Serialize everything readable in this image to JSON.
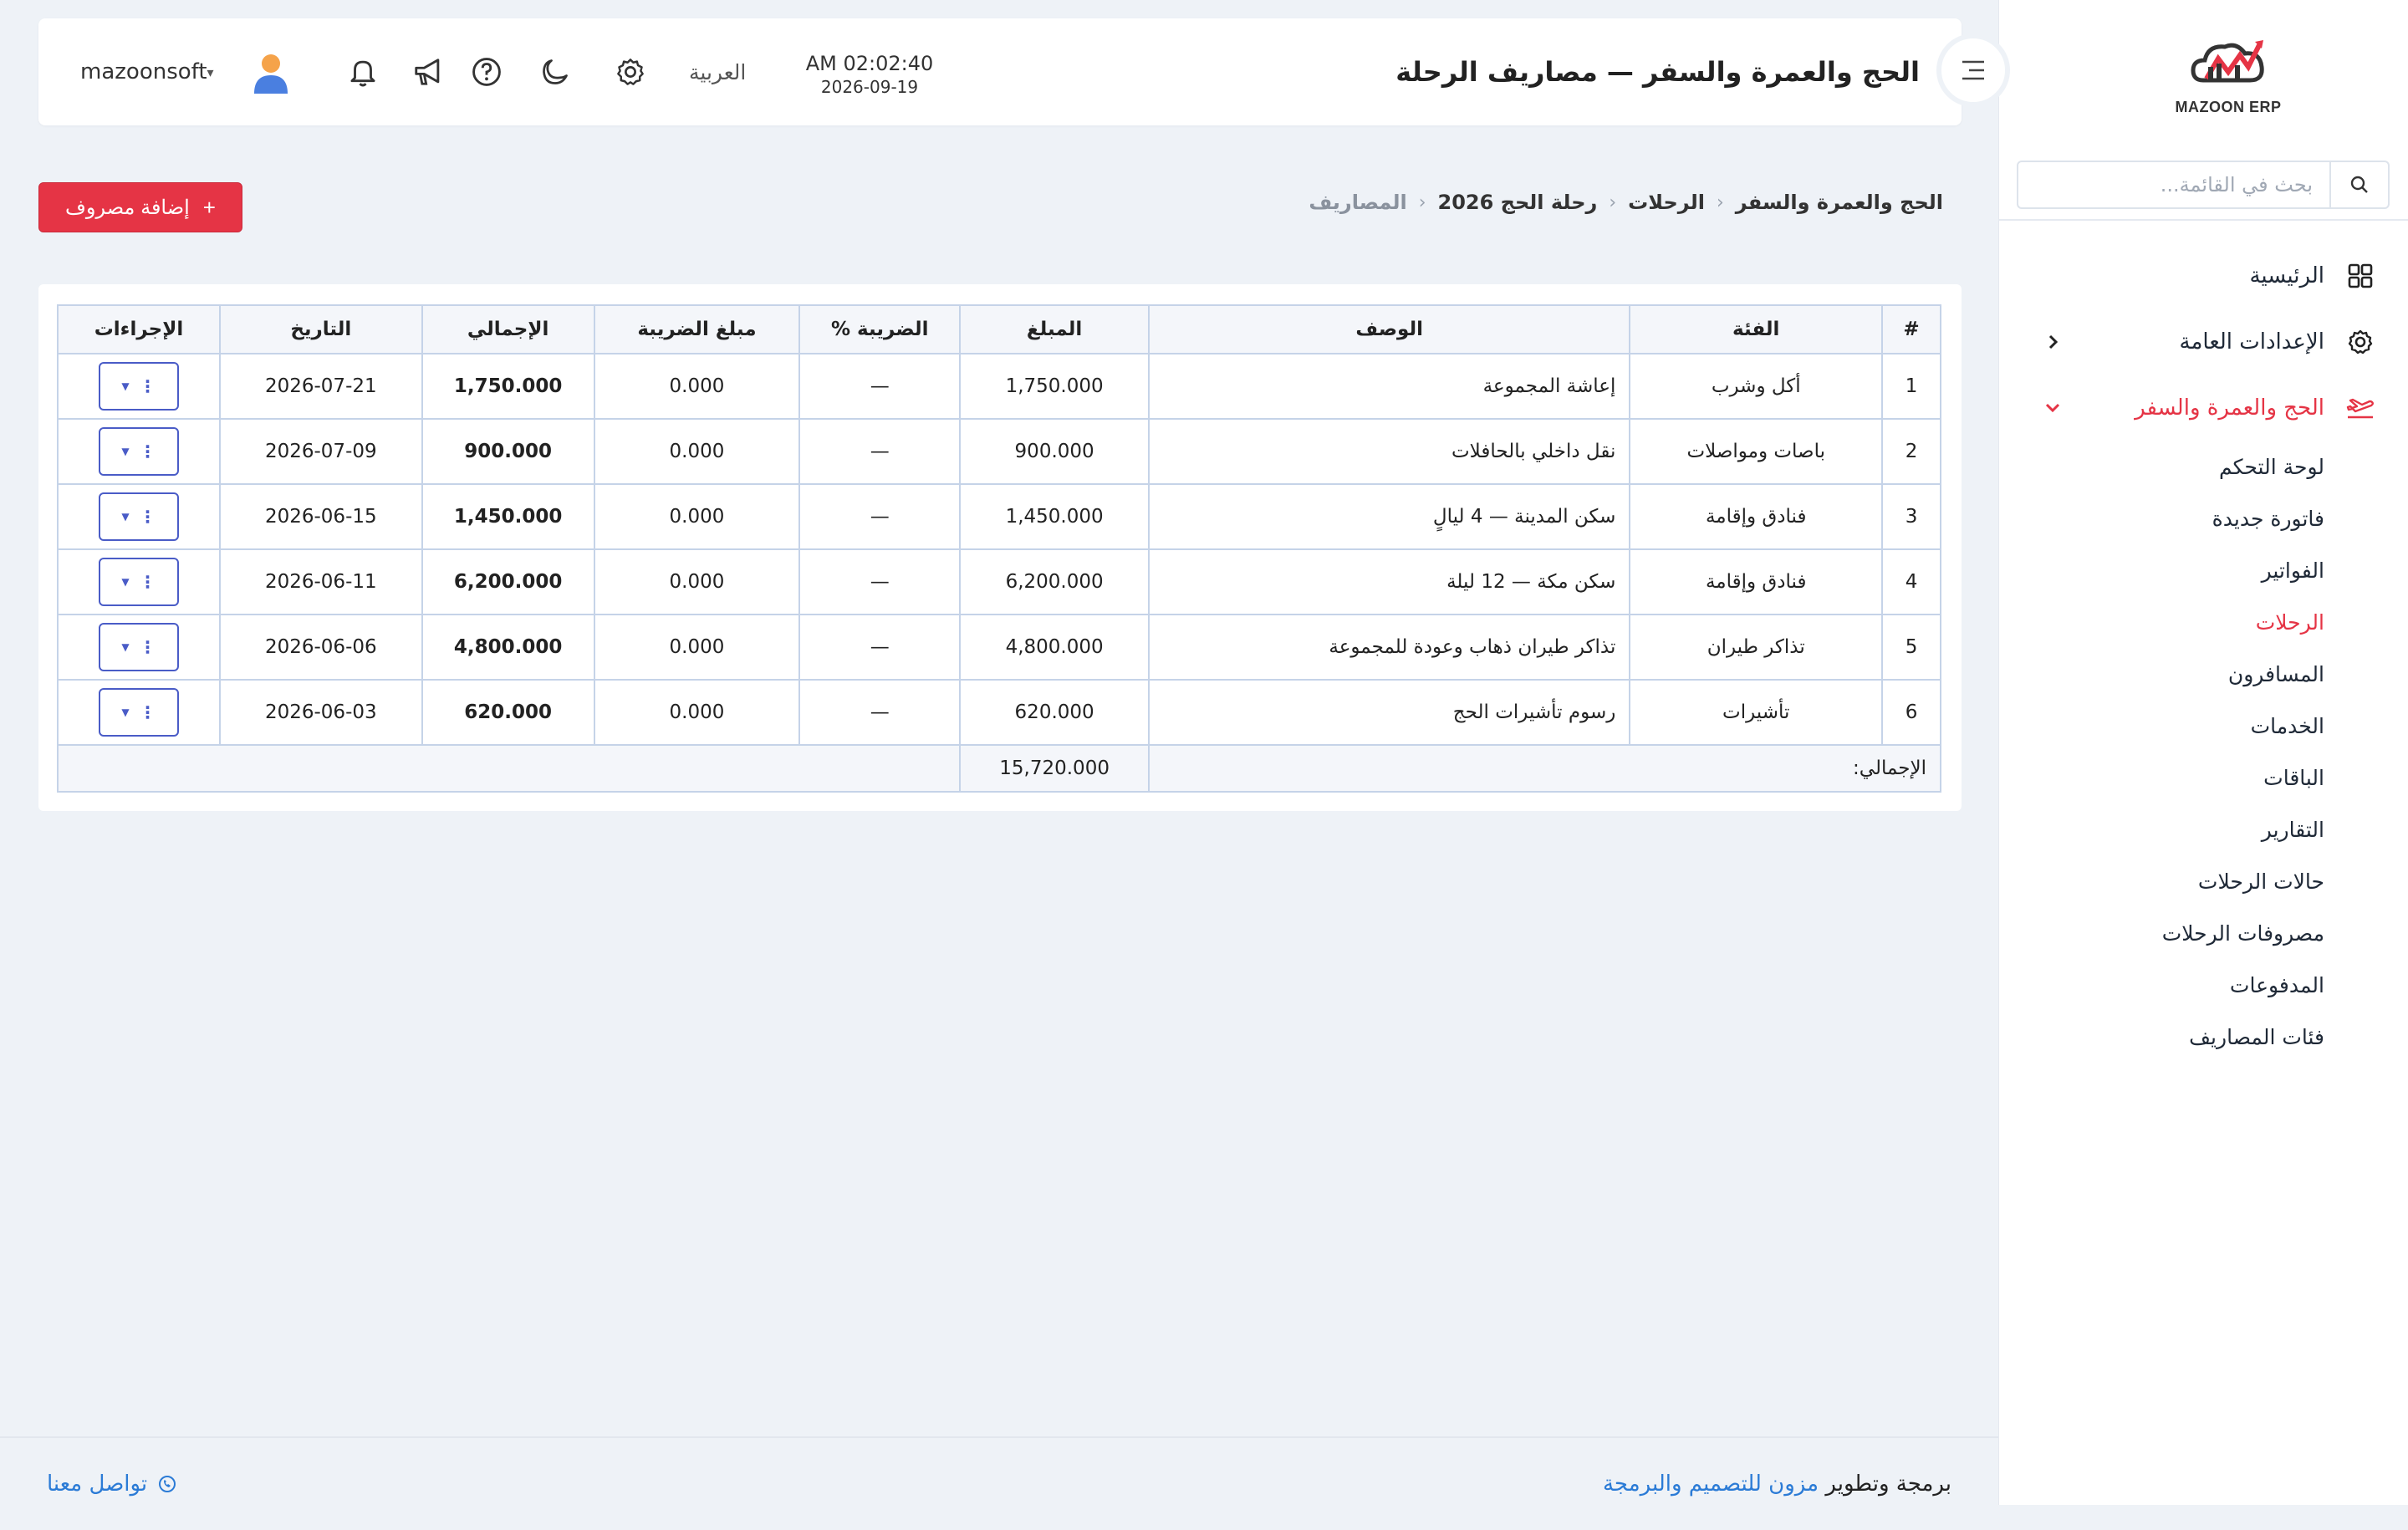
{
  "sidebar": {
    "logo_text": "MAZOON ERP",
    "search_placeholder": "بحث في القائمة...",
    "items": [
      {
        "label": "الرئيسية",
        "icon": "grid-icon"
      },
      {
        "label": "الإعدادات العامة",
        "icon": "gear-icon"
      },
      {
        "label": "الحج والعمرة والسفر",
        "icon": "plane-icon"
      }
    ],
    "subitems": [
      "لوحة التحكم",
      "فاتورة جديدة",
      "الفواتير",
      "الرحلات",
      "المسافرون",
      "الخدمات",
      "الباقات",
      "التقارير",
      "حالات الرحلات",
      "مصروفات الرحلات",
      "المدفوعات",
      "فئات المصاريف"
    ],
    "active_subitem": "الرحلات"
  },
  "header": {
    "title": "الحج والعمرة والسفر — مصاريف الرحلة",
    "time": "AM 02:02:40",
    "date": "2026-09-19",
    "language": "العربية",
    "username": "mazoonsoft"
  },
  "breadcrumb": [
    "الحج والعمرة والسفر",
    "الرحلات",
    "رحلة الحج 2026",
    "المصاريف"
  ],
  "actions": {
    "add_expense": "إضافة مصروف"
  },
  "table": {
    "headers": [
      "#",
      "الفئة",
      "الوصف",
      "المبلغ",
      "الضريبة %",
      "مبلغ الضريبة",
      "الإجمالي",
      "التاريخ",
      "الإجراءات"
    ],
    "rows": [
      {
        "num": "1",
        "category": "أكل وشرب",
        "description": "إعاشة المجموعة",
        "amount": "1,750.000",
        "tax_pct": "—",
        "tax_amount": "0.000",
        "total": "1,750.000",
        "date": "2026-07-21"
      },
      {
        "num": "2",
        "category": "باصات ومواصلات",
        "description": "نقل داخلي بالحافلات",
        "amount": "900.000",
        "tax_pct": "—",
        "tax_amount": "0.000",
        "total": "900.000",
        "date": "2026-07-09"
      },
      {
        "num": "3",
        "category": "فنادق وإقامة",
        "description": "سكن المدينة — 4 ليالٍ",
        "amount": "1,450.000",
        "tax_pct": "—",
        "tax_amount": "0.000",
        "total": "1,450.000",
        "date": "2026-06-15"
      },
      {
        "num": "4",
        "category": "فنادق وإقامة",
        "description": "سكن مكة — 12 ليلة",
        "amount": "6,200.000",
        "tax_pct": "—",
        "tax_amount": "0.000",
        "total": "6,200.000",
        "date": "2026-06-11"
      },
      {
        "num": "5",
        "category": "تذاكر طيران",
        "description": "تذاكر طيران ذهاب وعودة للمجموعة",
        "amount": "4,800.000",
        "tax_pct": "—",
        "tax_amount": "0.000",
        "total": "4,800.000",
        "date": "2026-06-06"
      },
      {
        "num": "6",
        "category": "تأشيرات",
        "description": "رسوم تأشيرات الحج",
        "amount": "620.000",
        "tax_pct": "—",
        "tax_amount": "0.000",
        "total": "620.000",
        "date": "2026-06-03"
      }
    ],
    "footer_label": "الإجمالي:",
    "footer_total": "15,720.000"
  },
  "footer": {
    "credit_prefix": "برمجة وتطوير",
    "company": "مزون للتصميم والبرمجة",
    "contact": "تواصل معنا"
  },
  "colors": {
    "accent": "#e53445",
    "link": "#2b7bd6",
    "action_border": "#4a5cc7"
  }
}
